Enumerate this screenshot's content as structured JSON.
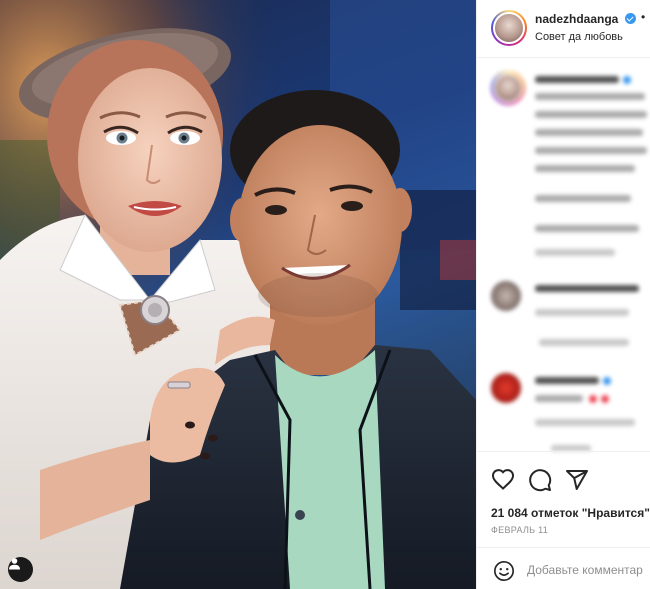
{
  "post": {
    "photo_alt": "",
    "tag_icon": "person-tag-icon"
  },
  "header": {
    "username": "nadezhdaanga",
    "verified": true,
    "separator": "•",
    "subtitle": "Совет да любовь"
  },
  "actions": {
    "like_icon": "heart-icon",
    "comment_icon": "comment-bubble-icon",
    "share_icon": "paper-plane-icon"
  },
  "likes": {
    "text": "21 084 отметок \"Нравится\""
  },
  "date": {
    "text": "ФЕВРАЛЬ 11"
  },
  "comment_box": {
    "emoji_icon": "emoji-smile-icon",
    "placeholder": "Добавьте комментар"
  },
  "colors": {
    "verified": "#3897f0",
    "text": "#262626",
    "muted": "#8e8e8e",
    "border": "#efefef"
  }
}
